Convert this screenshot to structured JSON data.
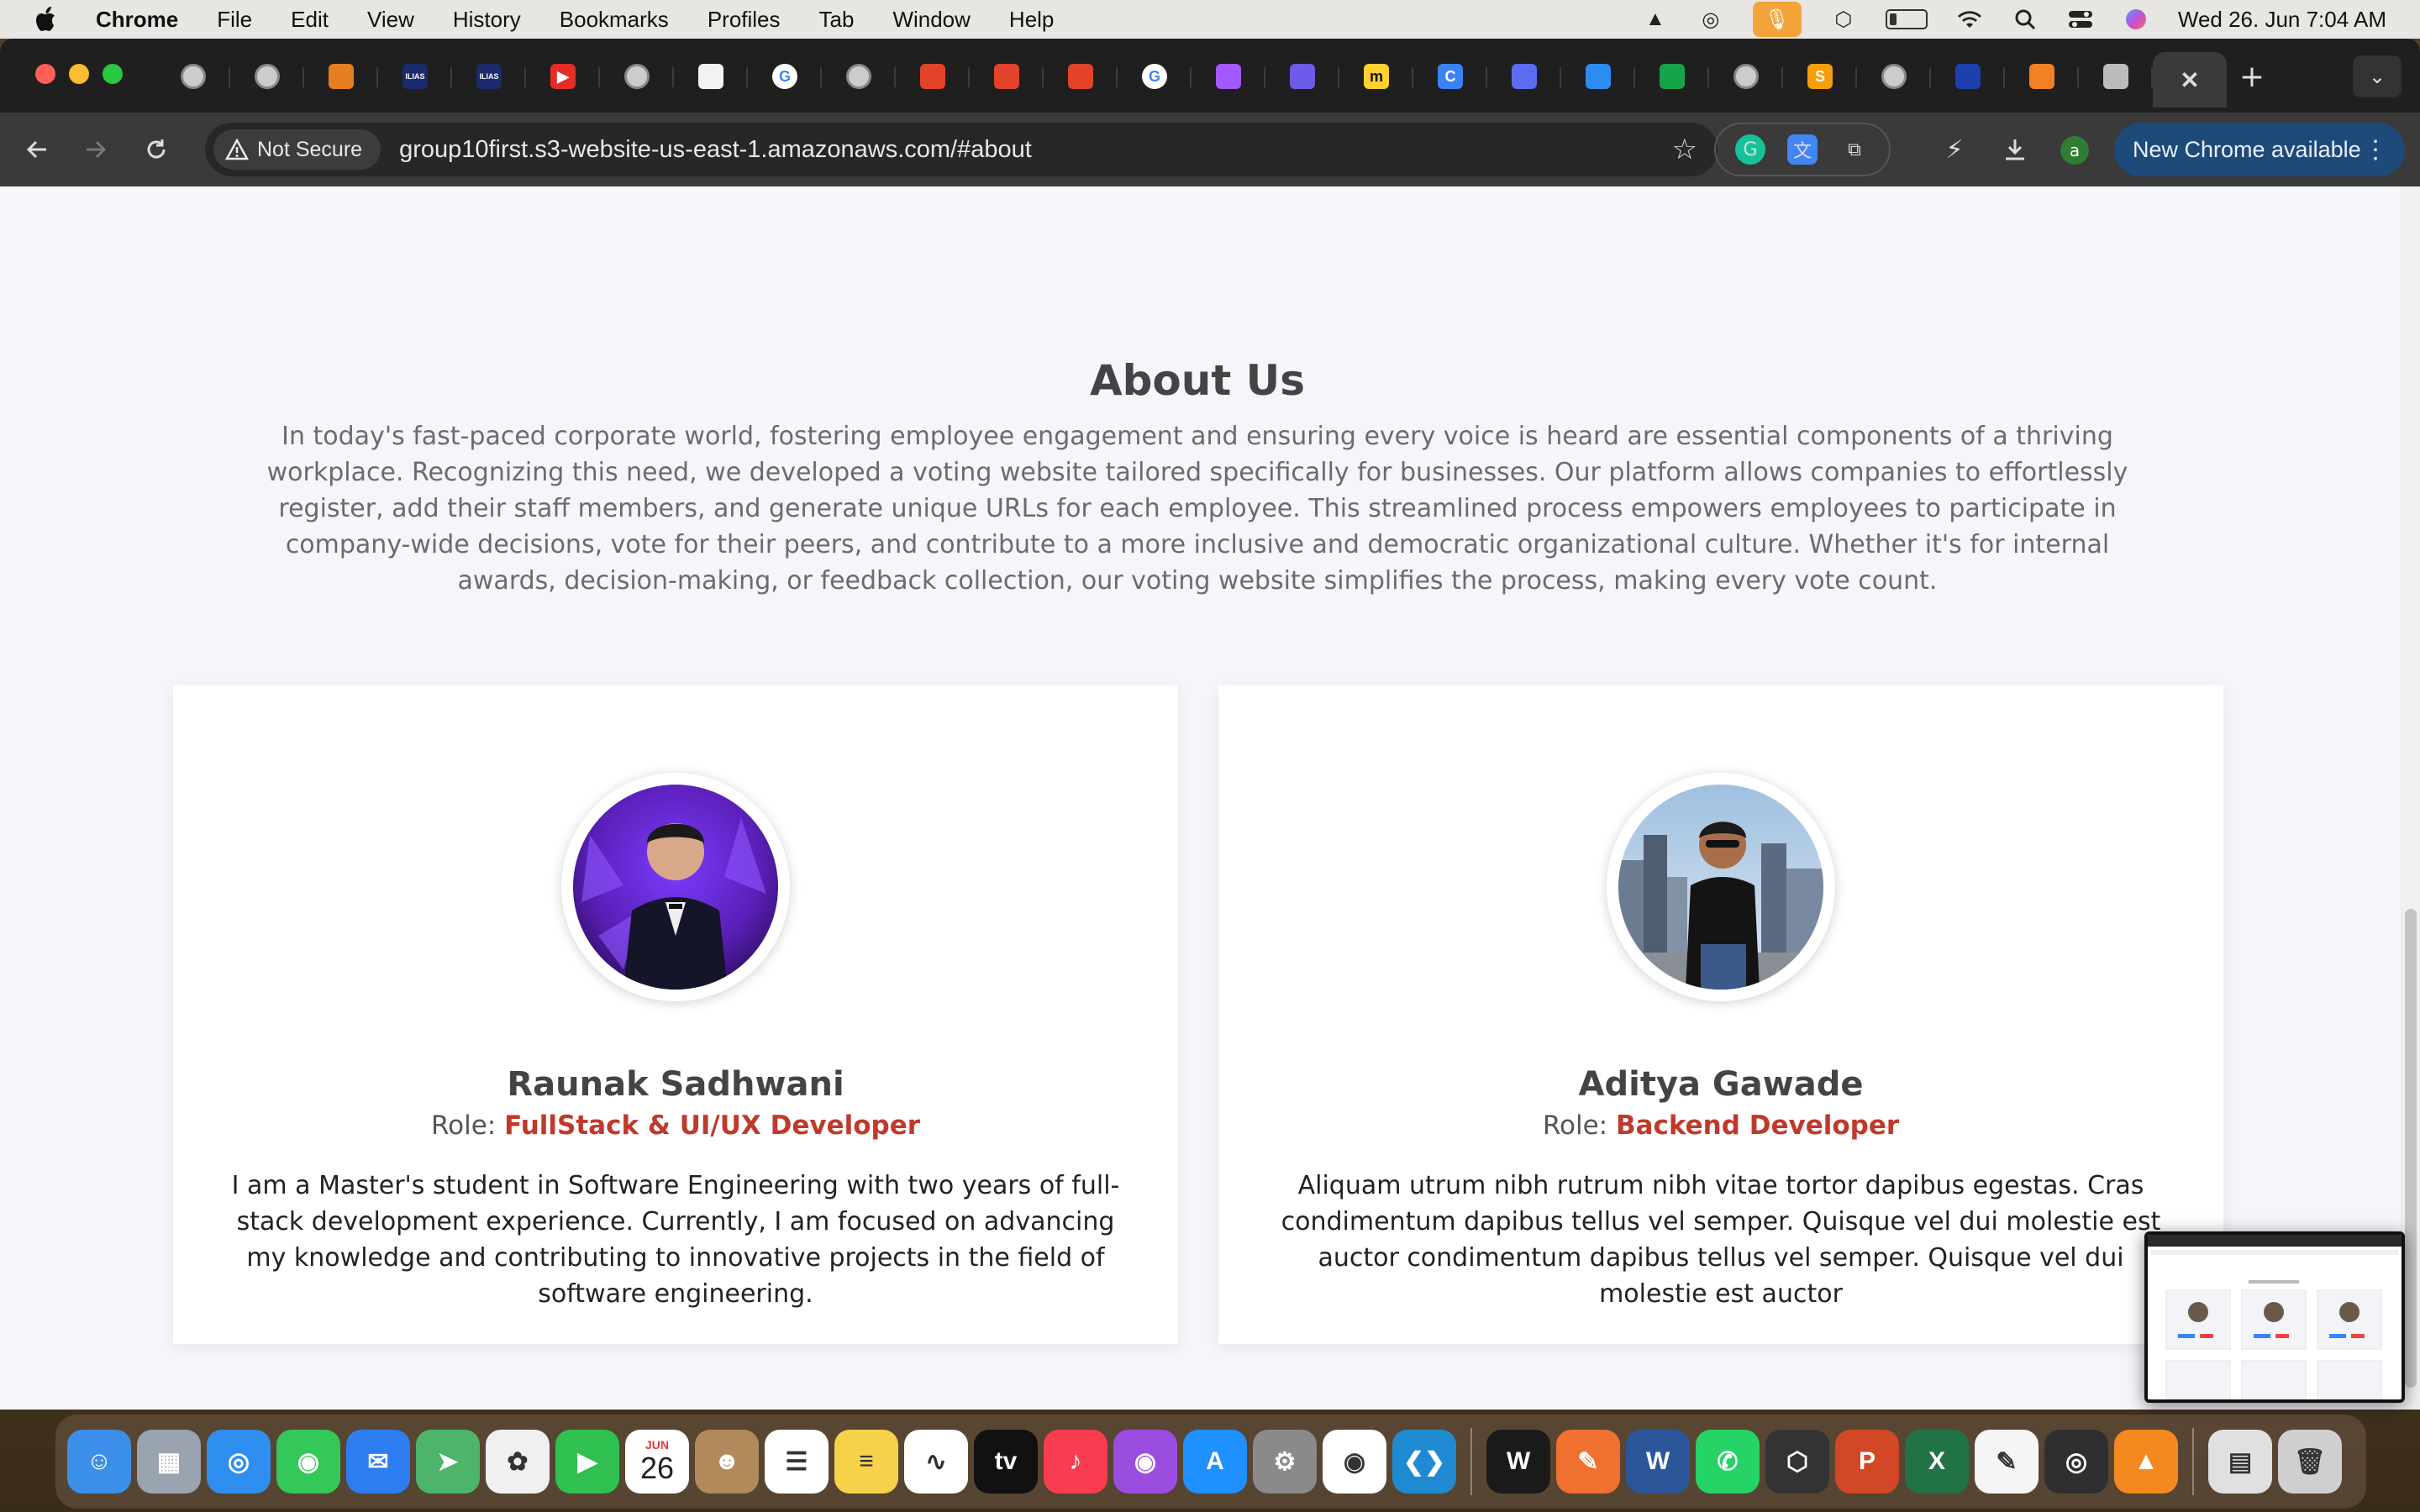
{
  "menubar": {
    "app_name": "Chrome",
    "items": [
      "File",
      "Edit",
      "View",
      "History",
      "Bookmarks",
      "Profiles",
      "Tab",
      "Window",
      "Help"
    ],
    "clock": "Wed 26. Jun  7:04 AM"
  },
  "browser": {
    "tabs": [
      {
        "icon": "globe-icon",
        "glyph": "",
        "color": "#7aa6d8"
      },
      {
        "icon": "globe-icon",
        "glyph": "",
        "color": "#888"
      },
      {
        "icon": "orange-app-icon",
        "glyph": "",
        "color": "#e67e22"
      },
      {
        "icon": "ilias-icon",
        "glyph": "ILIAS",
        "color": "#1a2a6c"
      },
      {
        "icon": "ilias-icon",
        "glyph": "ILIAS",
        "color": "#1a2a6c"
      },
      {
        "icon": "youtube-icon",
        "glyph": "▶",
        "color": "#e52d27"
      },
      {
        "icon": "globe-icon",
        "glyph": "",
        "color": "#888"
      },
      {
        "icon": "chatgpt-icon",
        "glyph": "",
        "color": "#f2f2f2"
      },
      {
        "icon": "google-icon",
        "glyph": "G",
        "color": "#ffffff"
      },
      {
        "icon": "globe-icon",
        "glyph": "",
        "color": "#888"
      },
      {
        "icon": "gitlab-icon",
        "glyph": "",
        "color": "#e24329"
      },
      {
        "icon": "gitlab-icon",
        "glyph": "",
        "color": "#e24329"
      },
      {
        "icon": "gitlab-icon",
        "glyph": "",
        "color": "#e24329"
      },
      {
        "icon": "google-icon",
        "glyph": "G",
        "color": "#ffffff"
      },
      {
        "icon": "figma-icon",
        "glyph": "",
        "color": "#a259ff"
      },
      {
        "icon": "cube-icon",
        "glyph": "",
        "color": "#6c5ce7"
      },
      {
        "icon": "miro-icon",
        "glyph": "m",
        "color": "#ffd02f"
      },
      {
        "icon": "c-app-icon",
        "glyph": "C",
        "color": "#3b82f6"
      },
      {
        "icon": "chat-icon",
        "glyph": "",
        "color": "#5b6cf0"
      },
      {
        "icon": "cloud-icon",
        "glyph": "",
        "color": "#2d8cf0"
      },
      {
        "icon": "sheet-icon",
        "glyph": "",
        "color": "#16a34a"
      },
      {
        "icon": "globe-icon",
        "glyph": "",
        "color": "#888"
      },
      {
        "icon": "s-app-icon",
        "glyph": "S",
        "color": "#f59e0b"
      },
      {
        "icon": "globe-icon",
        "glyph": "",
        "color": "#888"
      },
      {
        "icon": "person-icon",
        "glyph": "",
        "color": "#1e40af"
      },
      {
        "icon": "stackoverflow-icon",
        "glyph": "",
        "color": "#f48024"
      },
      {
        "icon": "openai-icon",
        "glyph": "",
        "color": "#bbb"
      },
      {
        "icon": "close-icon",
        "glyph": "✕",
        "color": "transparent",
        "active": true
      }
    ],
    "address": {
      "security_label": "Not Secure",
      "url": "group10first.s3-website-us-east-1.amazonaws.com/#about"
    },
    "profile_initial": "a",
    "update_label": "New Chrome available"
  },
  "about": {
    "title": "About Us",
    "description": "In today's fast-paced corporate world, fostering employee engagement and ensuring every voice is heard are essential components of a thriving workplace. Recognizing this need, we developed a voting website tailored specifically for businesses. Our platform allows companies to effortlessly register, add their staff members, and generate unique URLs for each employee. This streamlined process empowers employees to participate in company-wide decisions, vote for their peers, and contribute to a more inclusive and democratic organizational culture. Whether it's for internal awards, decision-making, or feedback collection, our voting website simplifies the process, making every vote count."
  },
  "team": [
    {
      "name": "Raunak Sadhwani",
      "role_label": "Role:",
      "role": "FullStack & UI/UX Developer",
      "bio": "I am a Master's student in Software Engineering with two years of full-stack development experience. Currently, I am focused on advancing my knowledge and contributing to innovative projects in the field of software engineering."
    },
    {
      "name": "Aditya Gawade",
      "role_label": "Role:",
      "role": "Backend Developer",
      "bio": "Aliquam utrum nibh rutrum nibh vitae tortor dapibus egestas. Cras condimentum dapibus tellus vel semper. Quisque vel dui molestie est auctor condimentum dapibus tellus vel semper. Quisque vel dui molestie est auctor"
    }
  ],
  "dock": {
    "calendar_month": "JUN",
    "calendar_day": "26",
    "apps": [
      {
        "name": "finder-icon",
        "color": "#3b8fe8",
        "glyph": "☺"
      },
      {
        "name": "launchpad-icon",
        "color": "#9aa3b0",
        "glyph": "▦"
      },
      {
        "name": "safari-icon",
        "color": "#2f8ff0",
        "glyph": "◎"
      },
      {
        "name": "messages-icon",
        "color": "#34c759",
        "glyph": "◉"
      },
      {
        "name": "mail-icon",
        "color": "#2c7df0",
        "glyph": "✉"
      },
      {
        "name": "maps-icon",
        "color": "#4cb56a",
        "glyph": "➤"
      },
      {
        "name": "photos-icon",
        "color": "#f0f0f0",
        "glyph": "✿"
      },
      {
        "name": "facetime-icon",
        "color": "#30c050",
        "glyph": "▶"
      },
      {
        "name": "calendar-icon",
        "color": "#ffffff",
        "glyph": ""
      },
      {
        "name": "contacts-icon",
        "color": "#b08a5a",
        "glyph": "☻"
      },
      {
        "name": "reminders-icon",
        "color": "#ffffff",
        "glyph": "☰"
      },
      {
        "name": "notes-icon",
        "color": "#f5d24a",
        "glyph": "≡"
      },
      {
        "name": "freeform-icon",
        "color": "#ffffff",
        "glyph": "∿"
      },
      {
        "name": "appletv-icon",
        "color": "#111111",
        "glyph": "tv"
      },
      {
        "name": "music-icon",
        "color": "#fa3c50",
        "glyph": "♪"
      },
      {
        "name": "podcasts-icon",
        "color": "#9b4de0",
        "glyph": "◉"
      },
      {
        "name": "appstore-icon",
        "color": "#1e90ff",
        "glyph": "A"
      },
      {
        "name": "settings-icon",
        "color": "#8a8a8a",
        "glyph": "⚙"
      },
      {
        "name": "chrome-icon",
        "color": "#ffffff",
        "glyph": "◉"
      },
      {
        "name": "vscode-icon",
        "color": "#1f8ad2",
        "glyph": "❮❯"
      },
      {
        "name": "webex-icon",
        "color": "#1a1a1a",
        "glyph": "W"
      },
      {
        "name": "pen-app-icon",
        "color": "#f07030",
        "glyph": "✎"
      },
      {
        "name": "word-icon",
        "color": "#2b579a",
        "glyph": "W"
      },
      {
        "name": "whatsapp-icon",
        "color": "#25d366",
        "glyph": "✆"
      },
      {
        "name": "unity-icon",
        "color": "#333333",
        "glyph": "⬡"
      },
      {
        "name": "powerpoint-icon",
        "color": "#d24726",
        "glyph": "P"
      },
      {
        "name": "excel-icon",
        "color": "#217346",
        "glyph": "X"
      },
      {
        "name": "textedit-icon",
        "color": "#f5f5f5",
        "glyph": "✎"
      },
      {
        "name": "obs-icon",
        "color": "#302e31",
        "glyph": "◎"
      },
      {
        "name": "vlc-icon",
        "color": "#f48a1f",
        "glyph": "▲"
      },
      {
        "name": "preview-icon",
        "color": "#e0e0e0",
        "glyph": "▤"
      },
      {
        "name": "trash-icon",
        "color": "#cfcfcf",
        "glyph": "🗑"
      }
    ]
  }
}
